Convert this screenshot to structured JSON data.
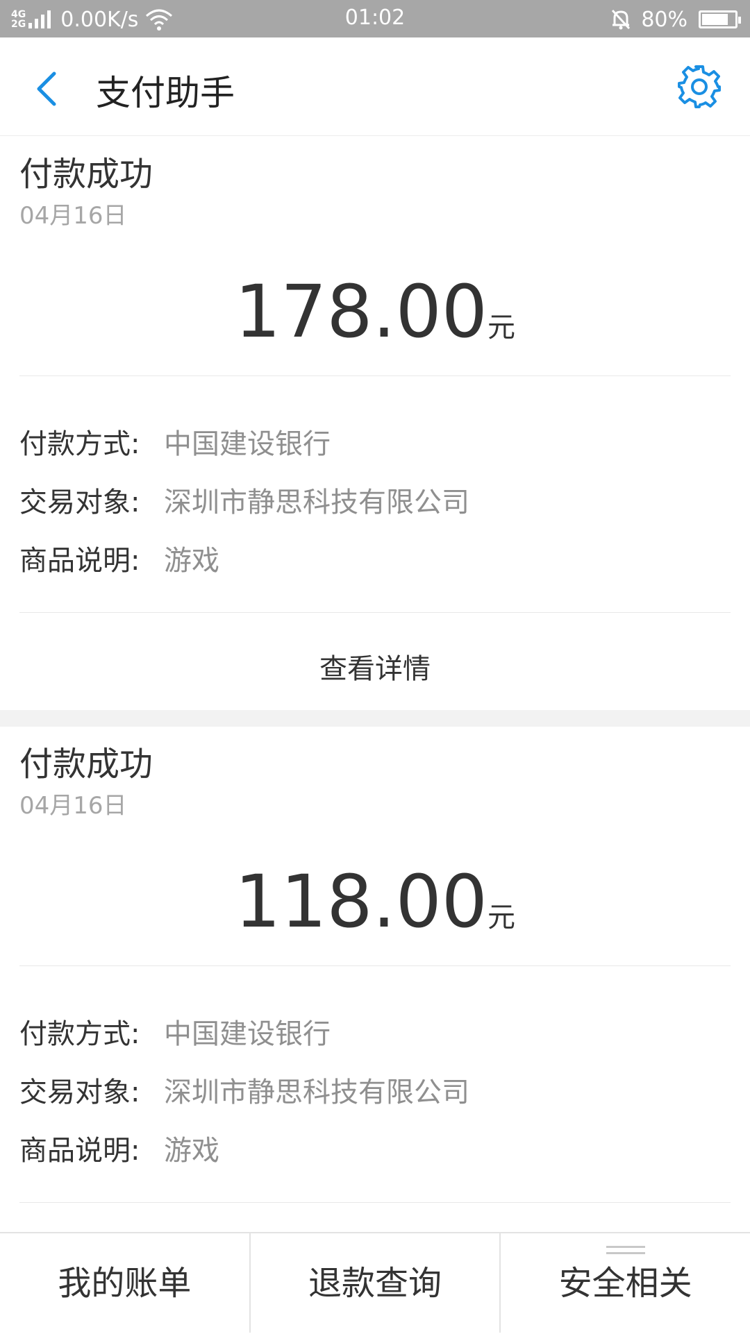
{
  "status_bar": {
    "network": "4G\n2G",
    "speed": "0.00K/s",
    "time": "01:02",
    "battery": "80%",
    "battery_level": 0.8
  },
  "header": {
    "title": "支付助手",
    "accent_color": "#1a8fe3"
  },
  "payments": [
    {
      "title": "付款成功",
      "date": "04月16日",
      "amount": "178.00",
      "unit": "元",
      "method_label": "付款方式:",
      "method_value": "中国建设银行",
      "counterparty_label": "交易对象:",
      "counterparty_value": "深圳市静思科技有限公司",
      "product_label": "商品说明:",
      "product_value": "游戏",
      "details_label": "查看详情"
    },
    {
      "title": "付款成功",
      "date": "04月16日",
      "amount": "118.00",
      "unit": "元",
      "method_label": "付款方式:",
      "method_value": "中国建设银行",
      "counterparty_label": "交易对象:",
      "counterparty_value": "深圳市静思科技有限公司",
      "product_label": "商品说明:",
      "product_value": "游戏"
    }
  ],
  "bottom_nav": {
    "items": [
      {
        "label": "我的账单"
      },
      {
        "label": "退款查询"
      },
      {
        "label": "安全相关"
      }
    ]
  }
}
